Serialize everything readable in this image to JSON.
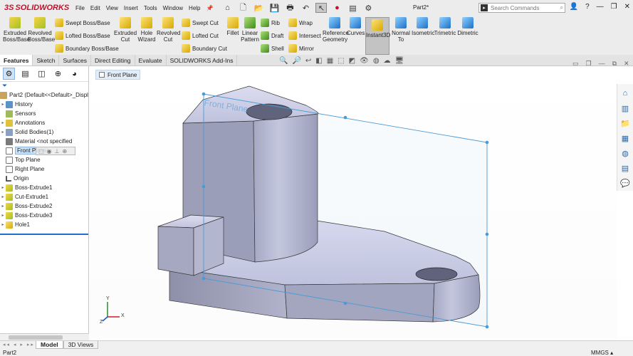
{
  "app": {
    "brand_ds": "3S",
    "brand_name": "SOLIDWORKS",
    "document": "Part2*"
  },
  "menus": [
    "File",
    "Edit",
    "View",
    "Insert",
    "Tools",
    "Window",
    "Help"
  ],
  "search": {
    "placeholder": "Search Commands"
  },
  "ribbon": {
    "extruded_boss": "Extruded Boss/Base",
    "revolved_boss": "Revolved Boss/Base",
    "swept_boss": "Swept Boss/Base",
    "lofted_boss": "Lofted Boss/Base",
    "boundary_boss": "Boundary Boss/Base",
    "extruded_cut": "Extruded Cut",
    "hole_wizard": "Hole Wizard",
    "revolved_cut": "Revolved Cut",
    "swept_cut": "Swept Cut",
    "lofted_cut": "Lofted Cut",
    "boundary_cut": "Boundary Cut",
    "fillet": "Fillet",
    "linear_pattern": "Linear Pattern",
    "rib": "Rib",
    "draft": "Draft",
    "shell": "Shell",
    "wrap": "Wrap",
    "intersect": "Intersect",
    "mirror": "Mirror",
    "reference_geometry": "Reference Geometry",
    "curves": "Curves",
    "instant3d": "Instant3D",
    "normal_to": "Normal To",
    "isometric": "Isometric",
    "trimetric": "Trimetric",
    "dimetric": "Dimetric"
  },
  "tabs": [
    "Features",
    "Sketch",
    "Surfaces",
    "Direct Editing",
    "Evaluate",
    "SOLIDWORKS Add-Ins"
  ],
  "tree": {
    "root": "Part2  (Default<<Default>_Displ",
    "items": [
      {
        "label": "History",
        "icon": "history-icon"
      },
      {
        "label": "Sensors",
        "icon": "sensor-icon"
      },
      {
        "label": "Annotations",
        "icon": "annotation-icon"
      },
      {
        "label": "Solid Bodies(1)",
        "icon": "solid-bodies-icon"
      },
      {
        "label": "Material <not specified>",
        "icon": "material-icon"
      },
      {
        "label": "Front Plane",
        "icon": "plane-icon"
      },
      {
        "label": "Top Plane",
        "icon": "plane-icon"
      },
      {
        "label": "Right Plane",
        "icon": "plane-icon"
      },
      {
        "label": "Origin",
        "icon": "origin-icon"
      },
      {
        "label": "Boss-Extrude1",
        "icon": "feature-icon"
      },
      {
        "label": "Cut-Extrude1",
        "icon": "feature-icon"
      },
      {
        "label": "Boss-Extrude2",
        "icon": "feature-icon"
      },
      {
        "label": "Boss-Extrude3",
        "icon": "feature-icon"
      },
      {
        "label": "Hole1",
        "icon": "hole-icon"
      }
    ]
  },
  "viewport": {
    "breadcrumb": "Front Plane",
    "plane_label": "Front Plane",
    "axis_x": "X",
    "axis_y": "Y",
    "axis_z": "Z"
  },
  "bottom_tabs": [
    "Model",
    "3D Views"
  ],
  "status": {
    "left": "Part2",
    "units": "MMGS"
  },
  "colors": {
    "accent": "#c8102e",
    "plane": "#4a9ad6",
    "model_light": "#cfd0e6",
    "model_dark": "#9a9bb6"
  }
}
